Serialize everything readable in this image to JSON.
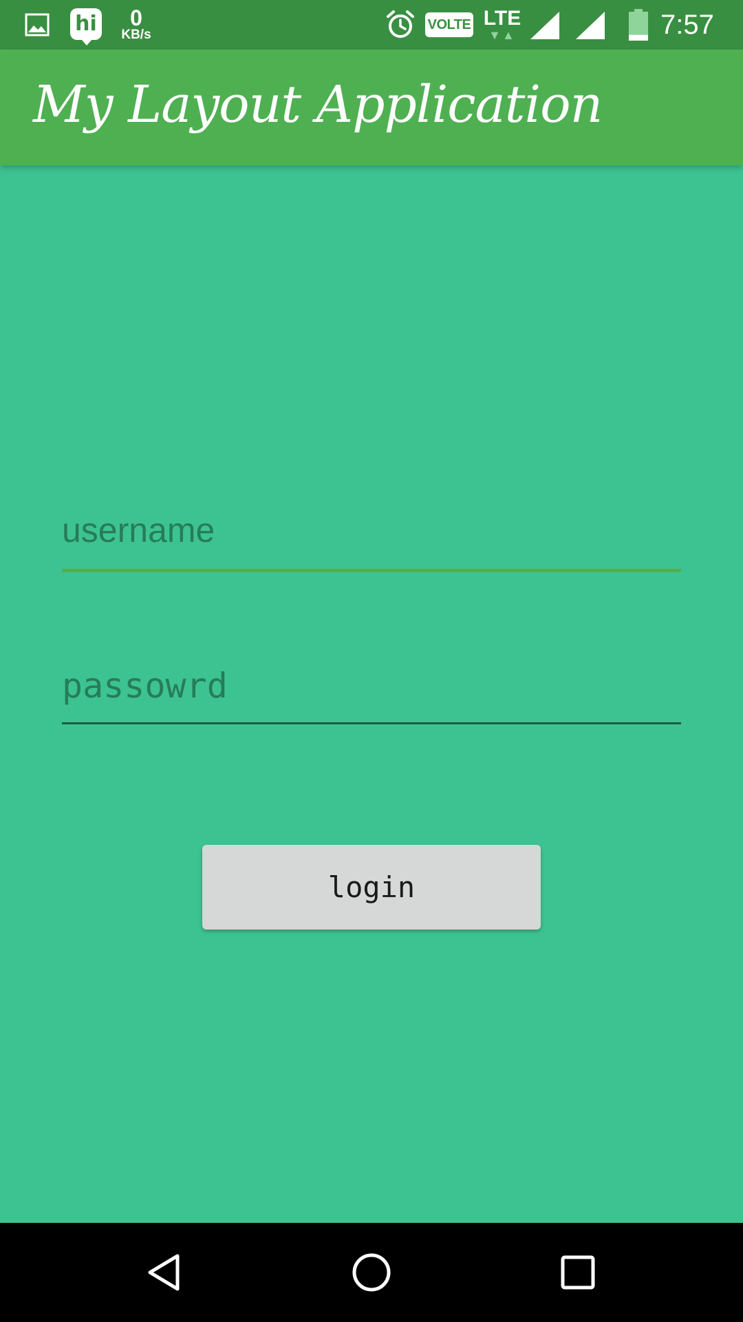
{
  "status_bar": {
    "app_icon": "hi",
    "network_speed_value": "0",
    "network_speed_unit": "KB/s",
    "volte_label": "VOLTE",
    "network_type": "LTE",
    "network_arrows": "▼▲",
    "time": "7:57",
    "icons": {
      "gallery": "image-icon",
      "alarm": "alarm-clock-icon",
      "signal": "signal-strength-icon",
      "battery": "battery-icon"
    },
    "battery_level": 0.2
  },
  "app_bar": {
    "title": "My Layout Application",
    "color": "#4fb052"
  },
  "form": {
    "username_placeholder": "username",
    "username_value": "",
    "password_placeholder": "passowrd",
    "password_value": "",
    "login_label": "login"
  },
  "nav_bar": {
    "back_icon": "back-triangle-icon",
    "home_icon": "home-circle-icon",
    "recents_icon": "recents-square-icon"
  },
  "colors": {
    "background": "#3dc392",
    "status_bar": "#398f41",
    "app_bar": "#4fb052",
    "button": "#d6d7d7",
    "hint_text": "#267d57"
  }
}
